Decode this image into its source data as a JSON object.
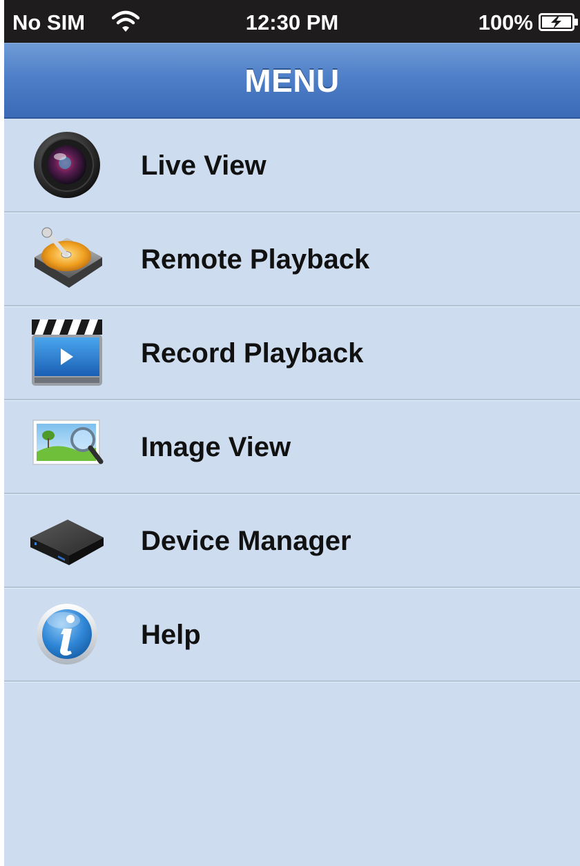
{
  "status_bar": {
    "carrier": "No SIM",
    "time": "12:30 PM",
    "battery": "100%",
    "wifi_icon": "wifi-icon",
    "battery_icon": "battery-charging-icon"
  },
  "nav": {
    "title": "MENU"
  },
  "menu": {
    "items": [
      {
        "label": "Live View",
        "icon": "camera-lens-icon"
      },
      {
        "label": "Remote Playback",
        "icon": "hard-drive-icon"
      },
      {
        "label": "Record Playback",
        "icon": "clapperboard-video-icon"
      },
      {
        "label": "Image View",
        "icon": "image-magnifier-icon"
      },
      {
        "label": "Device Manager",
        "icon": "dvr-device-icon"
      },
      {
        "label": "Help",
        "icon": "info-icon"
      }
    ]
  },
  "colors": {
    "background": "#cddcee",
    "nav_blue": "#4f7fc8",
    "status_bar": "#1f1c1d"
  }
}
